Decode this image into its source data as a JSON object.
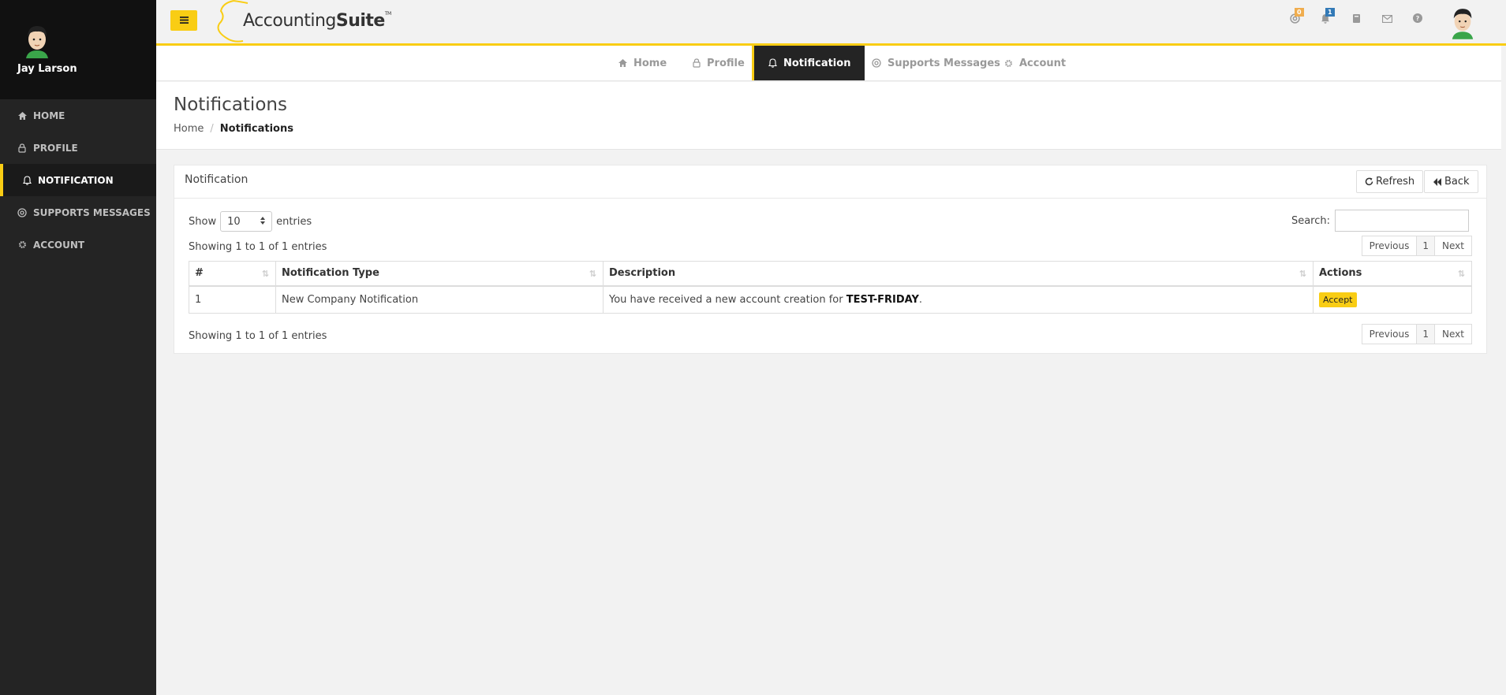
{
  "user": {
    "name": "Jay Larson"
  },
  "sidebar": {
    "items": [
      {
        "label": "HOME",
        "icon": "home-icon"
      },
      {
        "label": "PROFILE",
        "icon": "lock-icon"
      },
      {
        "label": "NOTIFICATION",
        "icon": "bell-icon",
        "active": true
      },
      {
        "label": "SUPPORTS MESSAGES",
        "icon": "lifebuoy-icon"
      },
      {
        "label": "ACCOUNT",
        "icon": "gear-icon"
      }
    ]
  },
  "topbar": {
    "logo_regular": "Accounting",
    "logo_bold": "Suite",
    "logo_tm": "TM",
    "badges": {
      "support": "0",
      "notifications": "1"
    }
  },
  "tabs": [
    {
      "label": "Home",
      "icon": "home-icon"
    },
    {
      "label": "Profile",
      "icon": "lock-icon"
    },
    {
      "label": "Notification",
      "icon": "bell-icon",
      "active": true
    },
    {
      "label": "Supports Messages",
      "icon": "lifebuoy-icon"
    },
    {
      "label": "Account",
      "icon": "gear-icon"
    }
  ],
  "page": {
    "title": "Notifications",
    "breadcrumb": {
      "home": "Home",
      "separator": "/",
      "current": "Notifications"
    }
  },
  "panel": {
    "title": "Notification",
    "refresh_label": "Refresh",
    "back_label": "Back",
    "show_label": "Show",
    "entries_label": "entries",
    "page_length": "10",
    "search_label": "Search:",
    "search_value": "",
    "info_text": "Showing 1 to 1 of 1 entries",
    "pager": {
      "previous": "Previous",
      "page": "1",
      "next": "Next"
    }
  },
  "table": {
    "columns": [
      "#",
      "Notification Type",
      "Description",
      "Actions"
    ],
    "rows": [
      {
        "num": "1",
        "type": "New Company Notification",
        "description_prefix": "You have received a new account creation for",
        "description_bold": "TEST-FRIDAY",
        "description_suffix": ".",
        "action": "Accept"
      }
    ]
  },
  "colors": {
    "accent": "#f9cd14",
    "sidebar": "#242424",
    "sidebar_top": "#111111"
  }
}
